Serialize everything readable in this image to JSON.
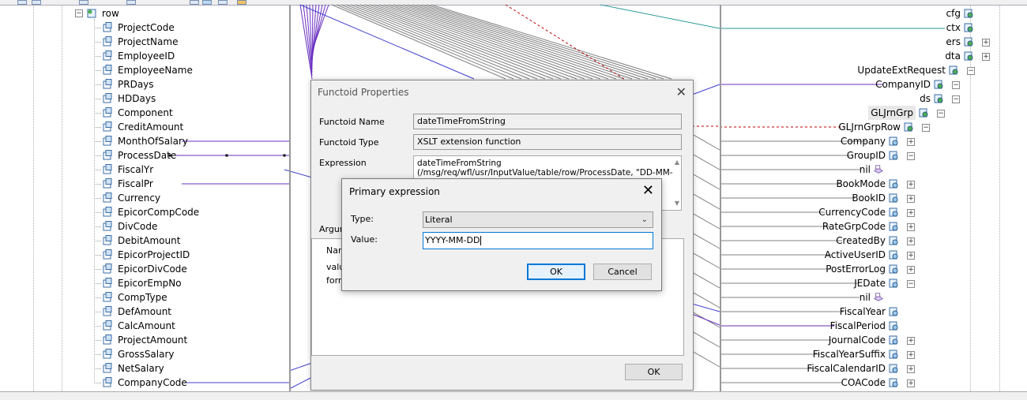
{
  "left_tree": {
    "root_label": "row",
    "items": [
      "ProjectCode",
      "ProjectName",
      "EmployeeID",
      "EmployeeName",
      "PRDays",
      "HDDays",
      "Component",
      "CreditAmount",
      "MonthOfSalary",
      "ProcessDate",
      "FiscalYr",
      "FiscalPr",
      "Currency",
      "EpicorCompCode",
      "DivCode",
      "DebitAmount",
      "EpicorProjectID",
      "EpicorDivCode",
      "EpicorEmpNo",
      "CompType",
      "DefAmount",
      "CalcAmount",
      "ProjectAmount",
      "GrossSalary",
      "NetSalary",
      "CompanyCode"
    ]
  },
  "right_tree": {
    "items": [
      "cfg",
      "ctx",
      "ers",
      "dta",
      "UpdateExtRequest",
      "CompanyID",
      "ds",
      "GLJrnGrp",
      "GLJrnGrpRow",
      "Company",
      "GroupID",
      "nil",
      "BookMode",
      "BookID",
      "CurrencyCode",
      "RateGrpCode",
      "CreatedBy",
      "ActiveUserID",
      "PostErrorLog",
      "JEDate",
      "nil",
      "FiscalYear",
      "FiscalPeriod",
      "JournalCode",
      "FiscalYearSuffix",
      "FiscalCalendarID",
      "COACode"
    ]
  },
  "functoid_dialog": {
    "title": "Functoid Properties",
    "name_label": "Functoid Name",
    "name_value": "dateTimeFromString",
    "type_label": "Functoid Type",
    "type_value": "XSLT extension function",
    "expression_label": "Expression",
    "expression_line1": "dateTimeFromString",
    "expression_line2": "(/msg/req/wfl/usr/InputValue/table/row/ProcessDate, \"DD-MM-",
    "arguments_label": "Argum",
    "args_header": "Nam",
    "args_row1": "valu",
    "args_row2": "form",
    "ok_label": "OK"
  },
  "primary_expression_dialog": {
    "title": "Primary expression",
    "type_label": "Type:",
    "type_value": "Literal",
    "value_label": "Value:",
    "value_input": "YYYY-MM-DD",
    "ok_label": "OK",
    "cancel_label": "Cancel"
  },
  "colors": {
    "link_purple": "#6a2fc0",
    "link_blue": "#4040d0",
    "link_teal": "#2a9a9a",
    "link_gray": "#808080",
    "link_red": "#c00000",
    "focus_blue": "#0078d7"
  }
}
